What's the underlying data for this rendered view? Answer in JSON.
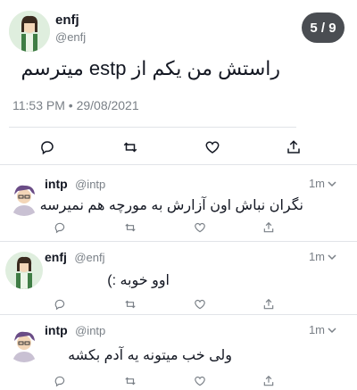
{
  "page_counter": "5 / 9",
  "main_tweet": {
    "display_name": "enfj",
    "handle": "@enfj",
    "text": "راستش من یکم از estp میترسم",
    "timestamp": "11:53 PM • 29/08/2021"
  },
  "replies": [
    {
      "display_name": "intp",
      "handle": "@intp",
      "time": "1m",
      "text": "نگران نباش اون آزارش به مورچه هم نمیرسه"
    },
    {
      "display_name": "enfj",
      "handle": "@enfj",
      "time": "1m",
      "text": "اوو خوبه :)"
    },
    {
      "display_name": "intp",
      "handle": "@intp",
      "time": "1m",
      "text": "ولی خب میتونه یه آدم بکشه"
    }
  ],
  "icons": [
    "reply-icon",
    "retweet-icon",
    "like-icon",
    "share-icon",
    "chevron-down-icon"
  ],
  "colors": {
    "text": "#141823",
    "muted": "#7a8087",
    "divider": "#e1e4e8",
    "counter_bg": "#4a4d52"
  }
}
